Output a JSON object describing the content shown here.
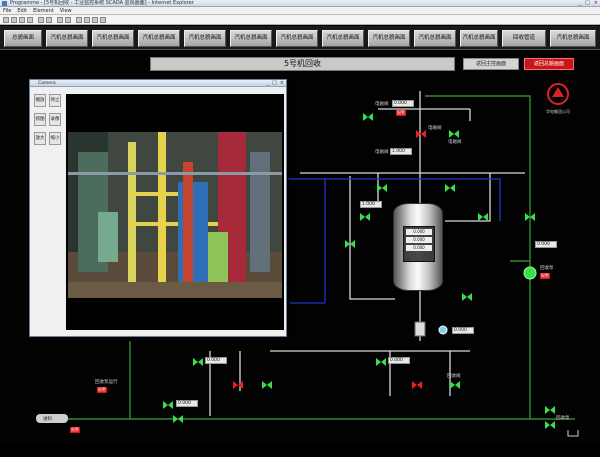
{
  "window": {
    "title": "Programme - [5号机回收 - 工业监控系统 SCADA 监视画面] - Internet Explorer",
    "controls": [
      "_",
      "□",
      "×"
    ]
  },
  "menu": [
    "File",
    "Edit",
    "Element",
    "View"
  ],
  "nav": [
    "总貌画面",
    "汽机总貌画面",
    "汽机总貌画面",
    "汽机总貌画面",
    "汽机总貌画面",
    "汽机总貌画面",
    "汽机总貌画面",
    "汽机总貌画面",
    "汽机总貌画面",
    "汽机总貌画面",
    "汽机总貌画面",
    "汽机总貌画面",
    "回收管道",
    "汽机总貌画面"
  ],
  "scada": {
    "unit_title": "5号机回收",
    "btn_left": "返回主控画面",
    "btn_right": "返回总貌画面",
    "logo_text": "华电集团公司",
    "top_valve_label": "电磁阀",
    "top_value": "0.000",
    "top_alarm": "报警",
    "v1_label": "电磁阀",
    "v1_value": "1.000",
    "v2_label": "电磁阀",
    "v2_value": "1.000",
    "v3_label": "电磁阀",
    "right_value": "0.000",
    "right_pump": "回收泵",
    "right_alarm": "报警",
    "tank_rows": [
      "0.000",
      "0.000",
      "0.000"
    ],
    "mid_value": "0.000",
    "lower_left_value": "0.000",
    "lower_right_value": "0.000",
    "lower_right_label": "回收阀",
    "bottom_left_label": "回收泵运行",
    "bottom_left_alarm": "报警",
    "bottom_value": "0.000",
    "bottom_pump_label": "回收泵",
    "left_label": "进料",
    "left_alarm": "报警"
  },
  "camera": {
    "title": "Camera",
    "buttons": [
      "播放",
      "停止",
      "抓图",
      "录像",
      "放大",
      "缩小"
    ]
  },
  "colors": {
    "pipe_white": "#d8d8d8",
    "pipe_blue": "#2233cc",
    "pipe_green": "#2e8b2e",
    "valve_green": "#37e04a",
    "valve_red": "#e52222",
    "alarm_red": "#d11111"
  }
}
